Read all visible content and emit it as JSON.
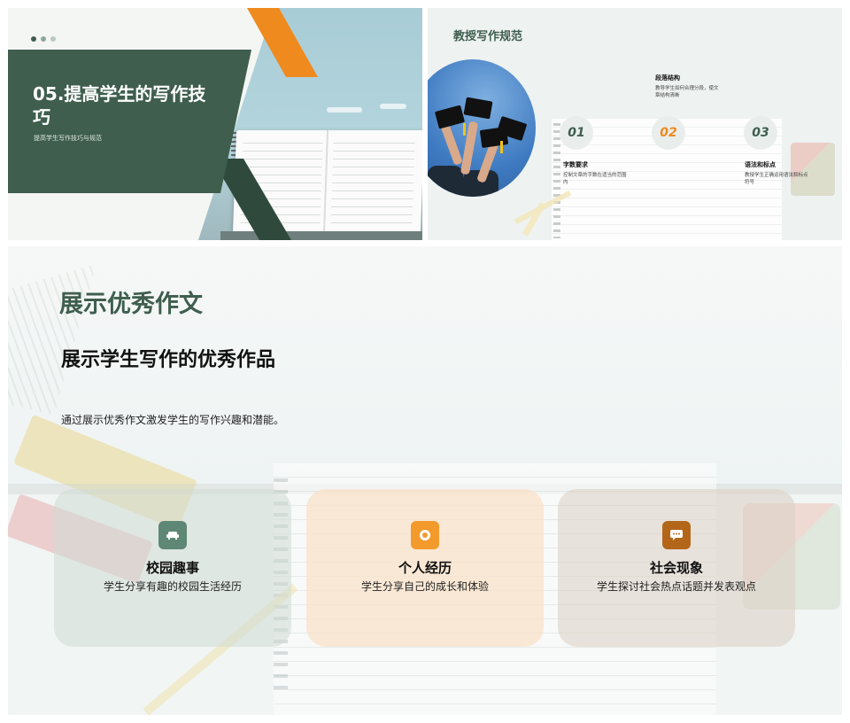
{
  "slide1": {
    "title": "05.提高学生的写作技巧",
    "subtitle": "提高学生写作技巧与规范",
    "dots": [
      "#3f5e4e",
      "#8fa69a",
      "#b9c9c1"
    ],
    "colors": {
      "green": "#3f5e4e",
      "orange": "#ef8a1f"
    }
  },
  "slide2": {
    "heading": "教授写作规范",
    "items": [
      {
        "number": "01",
        "title": "字数要求",
        "desc": "控制文章的字数在适当的范围内",
        "color": "#3f5e4e"
      },
      {
        "number": "02",
        "title": "段落结构",
        "desc": "教导学生如何合理分段，使文章结构清晰",
        "color": "#ef8a1f"
      },
      {
        "number": "03",
        "title": "语法和标点",
        "desc": "教授学生正确运用语法和标点符号",
        "color": "#3f5e4e"
      }
    ]
  },
  "slide3": {
    "heading": "展示优秀作文",
    "subheading": "展示学生写作的优秀作品",
    "intro": "通过展示优秀作文激发学生的写作兴趣和潜能。",
    "cards": [
      {
        "title": "校园趣事",
        "desc": "学生分享有趣的校园生活经历",
        "icon": "sofa-icon",
        "icon_color": "#5f8776",
        "bg": "rgba(208,218,212,0.55)"
      },
      {
        "title": "个人经历",
        "desc": "学生分享自己的成长和体验",
        "icon": "badge-icon",
        "icon_color": "#f39a2c",
        "bg": "rgba(250,226,200,0.75)"
      },
      {
        "title": "社会现象",
        "desc": "学生探讨社会热点话题并发表观点",
        "icon": "chat-icon",
        "icon_color": "#b3661a",
        "bg": "rgba(220,210,198,0.6)"
      }
    ]
  }
}
